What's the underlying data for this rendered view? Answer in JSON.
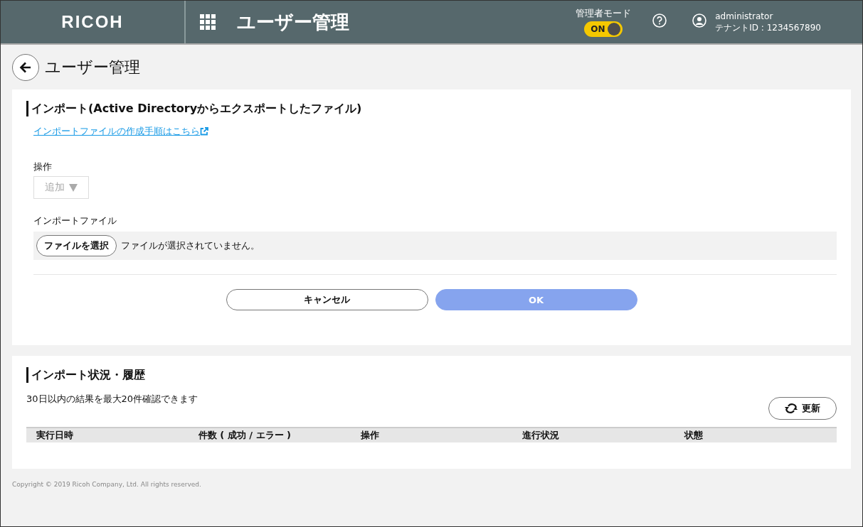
{
  "header": {
    "logo": "RICOH",
    "app_title": "ユーザー管理",
    "admin_mode": {
      "label": "管理者モード",
      "toggle_text": "ON",
      "on": true
    },
    "user": {
      "name": "administrator",
      "tenant": "テナントID : 1234567890"
    }
  },
  "page_title": "ユーザー管理",
  "import_section": {
    "title": "インポート(Active Directoryからエクスポートしたファイル)",
    "help_link": "インポートファイルの作成手順はこちら",
    "operation": {
      "label": "操作",
      "value": "追加",
      "disabled": true
    },
    "file": {
      "label": "インポートファイル",
      "button": "ファイルを選択",
      "status": "ファイルが選択されていません。"
    },
    "buttons": [
      {
        "label": "キャンセル",
        "kind": "secondary",
        "disabled": false
      },
      {
        "label": "OK",
        "kind": "primary",
        "disabled": true
      }
    ]
  },
  "history_section": {
    "title": "インポート状況・履歴",
    "note": "30日以内の結果を最大20件確認できます",
    "refresh_button": "更新",
    "columns": [
      "実行日時",
      "件数 ( 成功 / エラー )",
      "操作",
      "進行状況",
      "状態"
    ]
  },
  "footer": "Copyright © 2019 Ricoh Company, Ltd. All rights reserved."
}
